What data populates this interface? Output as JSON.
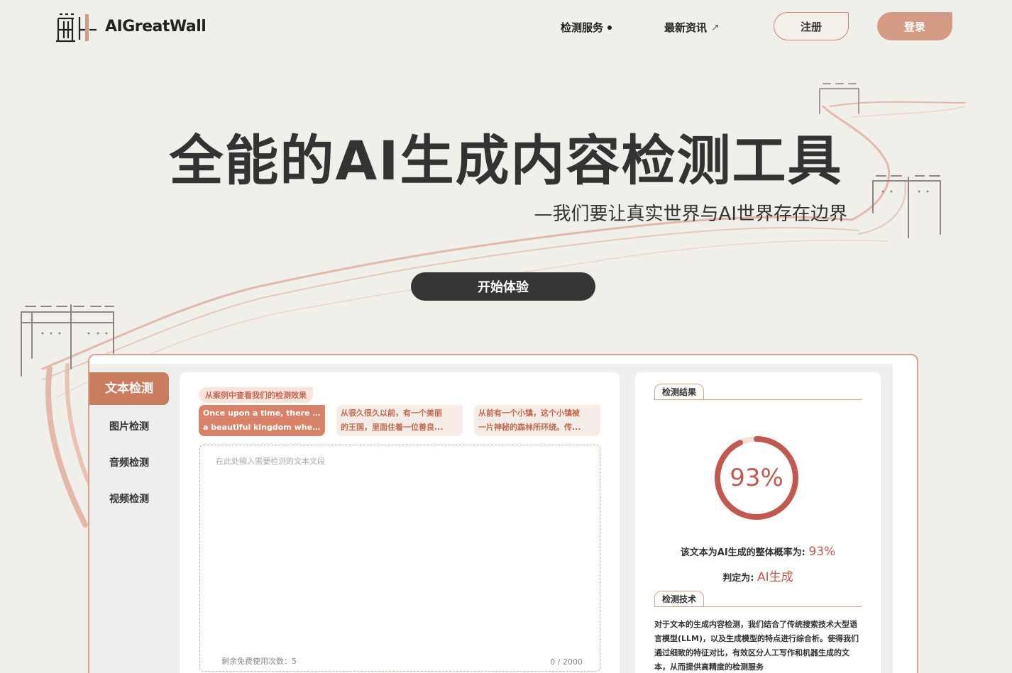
{
  "brand": {
    "name": "AIGreatWall"
  },
  "nav": {
    "detect_service": "检测服务",
    "news": "最新资讯",
    "news_arrow": "↗",
    "register": "注册",
    "login": "登录"
  },
  "hero": {
    "title": "全能的AI生成内容检测工具",
    "subtitle": "—我们要让真实世界与AI世界存在边界",
    "cta": "开始体验"
  },
  "sidebar": {
    "items": [
      {
        "label": "文本检测",
        "active": true
      },
      {
        "label": "图片检测"
      },
      {
        "label": "音频检测"
      },
      {
        "label": "视频检测"
      }
    ]
  },
  "editor": {
    "examples_label": "从案例中查看我们的检测效果",
    "examples": [
      {
        "line1": "Once upon a time, there was",
        "line2": "a beautiful kingdom where..."
      },
      {
        "line1": "从很久很久以前，有一个美丽",
        "line2": "的王国，里面住着一位善良..."
      },
      {
        "line1": "从前有一个小镇，这个小镇被",
        "line2": "一片神秘的森林所环绕。传..."
      }
    ],
    "placeholder": "在此处输入需要检测的文本文段",
    "remaining": "剩余免费使用次数：5",
    "counter": "0 / 2000"
  },
  "result": {
    "section_title": "检测结果",
    "percent": "93%",
    "percent_value": 93,
    "prob_label": "该文本为AI生成的整体概率为:",
    "prob_value": "93%",
    "verdict_label": "判定为:",
    "verdict_value": "AI生成",
    "tech_title": "检测技术",
    "tech_desc": "对于文本的生成内容检测，我们结合了传统搜索技术大型语言模型(LLM)，以及生成模型的特点进行综合析。使得我们通过细致的特征对比，有效区分人工写作和机器生成的文本，从而提供高精度的检测服务"
  },
  "colors": {
    "accent": "#d39a84",
    "accent_dark": "#c97c5e",
    "result_red": "#c25950",
    "background": "#f1efea"
  }
}
